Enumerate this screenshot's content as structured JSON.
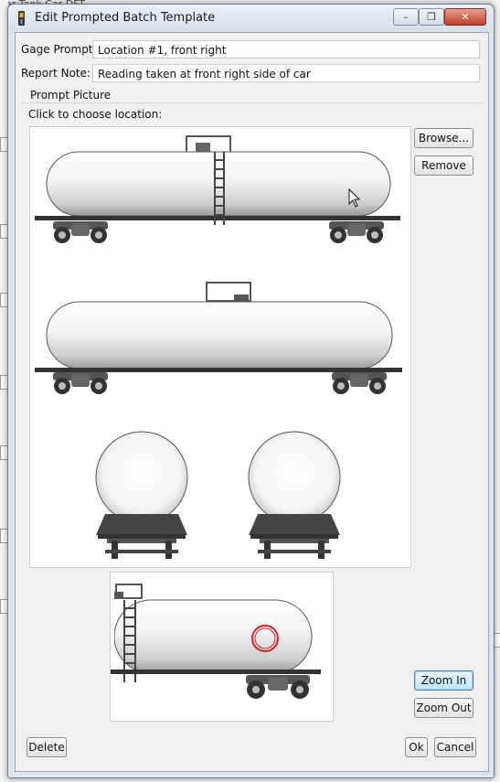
{
  "background": {
    "title": "er Tank Car DFT"
  },
  "window": {
    "title": "Edit Prompted Batch Template",
    "minimize": "–",
    "restore": "❐",
    "close": "✕"
  },
  "form": {
    "gage_prompt_label": "Gage Prompt:",
    "gage_prompt_value": "Location #1, front right",
    "report_note_label": "Report Note:",
    "report_note_value": "Reading taken at front right side of car"
  },
  "prompt_picture": {
    "group_label": "Prompt Picture",
    "instruction": "Click to choose location:",
    "views": [
      "side-view-right",
      "side-view-left",
      "end-view-front",
      "end-view-rear"
    ],
    "zoom_view": "side-view-right-zoomed",
    "marker_color": "#d42020"
  },
  "buttons": {
    "browse": "Browse...",
    "remove": "Remove",
    "zoom_in": "Zoom In",
    "zoom_out": "Zoom Out",
    "delete": "Delete",
    "ok": "Ok",
    "cancel": "Cancel"
  }
}
